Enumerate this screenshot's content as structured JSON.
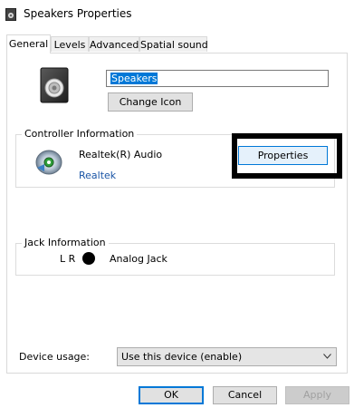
{
  "window": {
    "title": "Speakers Properties",
    "title_icon": "speaker-icon"
  },
  "tabs": [
    {
      "label": "General",
      "active": true
    },
    {
      "label": "Levels",
      "active": false
    },
    {
      "label": "Advanced",
      "active": false
    },
    {
      "label": "Spatial sound",
      "active": false
    }
  ],
  "general": {
    "device_name": "Speakers",
    "change_icon_label": "Change Icon",
    "controller": {
      "group_label": "Controller Information",
      "name": "Realtek(R) Audio",
      "vendor_link": "Realtek",
      "properties_label": "Properties"
    },
    "jack": {
      "group_label": "Jack Information",
      "channels": "L R",
      "type": "Analog Jack"
    },
    "device_usage": {
      "label": "Device usage:",
      "selected": "Use this device (enable)"
    }
  },
  "footer": {
    "ok_label": "OK",
    "cancel_label": "Cancel",
    "apply_label": "Apply"
  },
  "colors": {
    "accent": "#0078d7",
    "link": "#1a55a6",
    "highlight_box": "#000000"
  }
}
